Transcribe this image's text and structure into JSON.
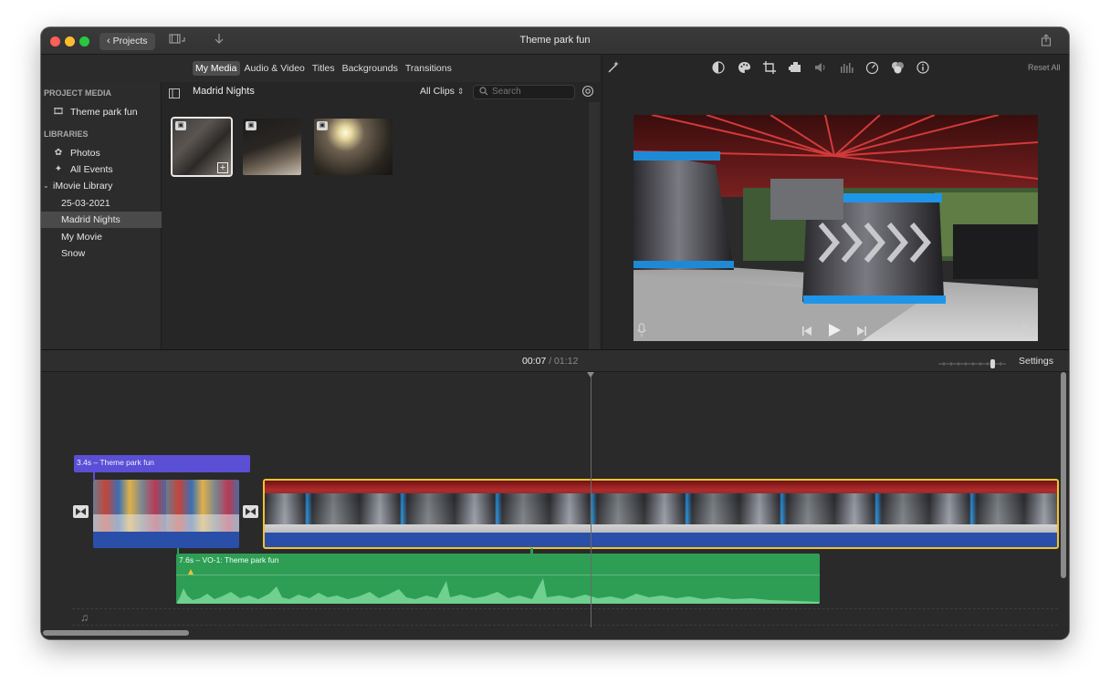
{
  "window": {
    "title": "Theme park fun"
  },
  "toolbar": {
    "projects_label": "Projects"
  },
  "media_tabs": [
    "My Media",
    "Audio & Video",
    "Titles",
    "Backgrounds",
    "Transitions"
  ],
  "sidebar": {
    "project_media_header": "PROJECT MEDIA",
    "project_item": "Theme park fun",
    "libraries_header": "LIBRARIES",
    "items": [
      {
        "label": "Photos",
        "icon": "flower-icon"
      },
      {
        "label": "All Events",
        "icon": "star-icon"
      },
      {
        "label": "iMovie Library",
        "icon": "disclosure-icon"
      },
      {
        "label": "25-03-2021",
        "icon": ""
      },
      {
        "label": "Madrid Nights",
        "icon": ""
      },
      {
        "label": "My Movie",
        "icon": ""
      },
      {
        "label": "Snow",
        "icon": ""
      }
    ]
  },
  "browser": {
    "event_title": "Madrid Nights",
    "filter_label": "All Clips",
    "search_placeholder": "Search"
  },
  "viewer": {
    "reset_label": "Reset All"
  },
  "timeline": {
    "current_time": "00:07",
    "separator": "/",
    "total_time": "01:12",
    "settings_label": "Settings",
    "title_clip_label": "3.4s – Theme park fun",
    "audio_clip_label": "7.6s – VO-1: Theme park fun"
  },
  "colors": {
    "window_bg": "#262626",
    "title_clip": "#5b4fd6",
    "audio_clip": "#2e9e55",
    "video_strip": "#2a4fa8",
    "selection": "#f2c230"
  }
}
